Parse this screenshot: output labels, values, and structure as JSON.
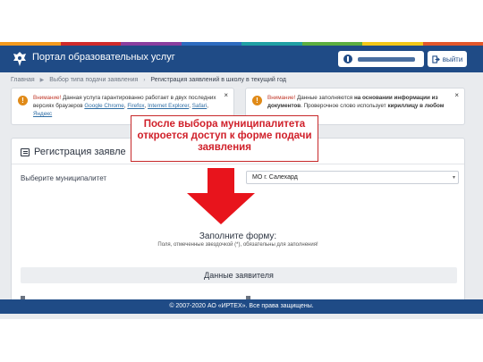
{
  "colors": {
    "header": "#1f4b86",
    "stripe": [
      "#f39a1e",
      "#cf2b2b",
      "#8a3e9e",
      "#2d6bbf",
      "#1fa0a4",
      "#5cae3f",
      "#f2c718",
      "#e2572b"
    ],
    "callout": "#d0202a",
    "warning": "#e08a18"
  },
  "header": {
    "portal_title": "Портал образовательных услуг",
    "logout_label": "выйти",
    "logo_icon": "coat-of-arms-icon",
    "user_icon": "user-info-icon",
    "logout_icon": "logout-icon"
  },
  "breadcrumb": {
    "items": [
      "Главная",
      "Выбор типа подачи заявления",
      "Регистрация заявлений в школу в текущий год"
    ]
  },
  "alerts": {
    "left": {
      "attention": "Внимание!",
      "text1": " Данная услуга гарантированно работает в двух последних версиях браузеров ",
      "browsers": [
        "Google Chrome",
        "Firefox",
        "Internet Explorer",
        "Safari",
        "Яндекс"
      ]
    },
    "right": {
      "attention": "Внимание!",
      "text1": " Данные заполняются ",
      "bold1": "на основании информации из документов",
      "text2": ". Проверочное слово использует ",
      "bold2": "кириллицу в любом"
    },
    "close": "×"
  },
  "panel": {
    "title": "Регистрация заявле",
    "muni_label": "Выберите муниципалитет",
    "muni_value": "МО г. Салехард",
    "form_heading": "Заполните форму:",
    "form_note": "Поля, отмеченные звездочкой (*), обязательны для заполнения!",
    "section_title": "Данные заявителя"
  },
  "footer": {
    "copyright": "© 2007-2020 АО «ИРТЕХ». Все права защищены."
  },
  "callout": {
    "text": "После выбора муниципалитета откроется доступ к форме подачи заявления"
  }
}
